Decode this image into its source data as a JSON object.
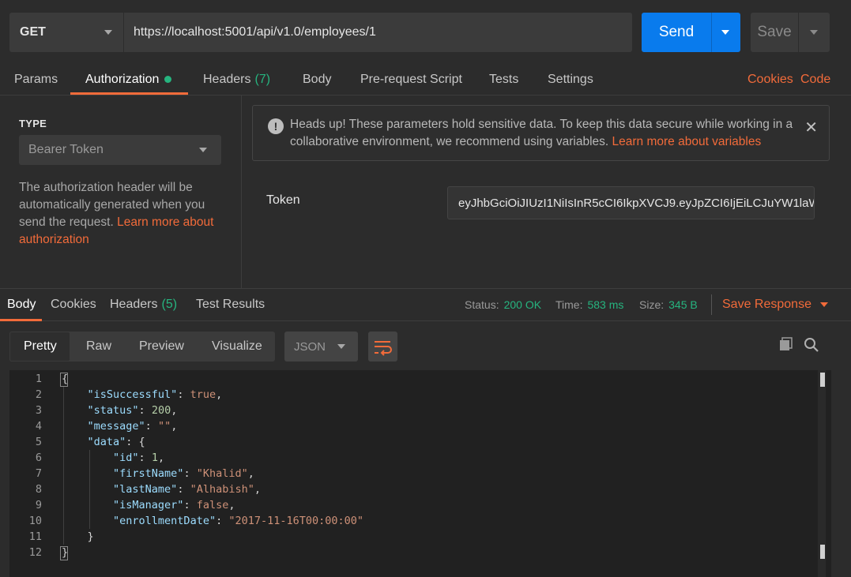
{
  "request": {
    "method": "GET",
    "url": "https://localhost:5001/api/v1.0/employees/1",
    "send_label": "Send",
    "save_label": "Save"
  },
  "request_tabs": {
    "params": "Params",
    "authorization": "Authorization",
    "headers": "Headers",
    "headers_count": "(7)",
    "body": "Body",
    "prerequest": "Pre-request Script",
    "tests": "Tests",
    "settings": "Settings",
    "cookies": "Cookies",
    "code": "Code"
  },
  "auth": {
    "type_label": "TYPE",
    "type_value": "Bearer Token",
    "desc_text": "The authorization header will be automatically generated when you send the request. ",
    "desc_link": "Learn more about authorization",
    "notice_text": "Heads up! These parameters hold sensitive data. To keep this data secure while working in a collaborative environment, we recommend using variables. ",
    "notice_link": "Learn more about variables",
    "token_label": "Token",
    "token_value": "eyJhbGciOiJIUzI1NiIsInR5cCI6IkpXVCJ9.eyJpZCI6IjEiLCJuYW1laW…"
  },
  "response_tabs": {
    "body": "Body",
    "cookies": "Cookies",
    "headers": "Headers",
    "headers_count": "(5)",
    "test_results": "Test Results"
  },
  "response_status": {
    "status_label": "Status:",
    "status_value": "200 OK",
    "time_label": "Time:",
    "time_value": "583 ms",
    "size_label": "Size:",
    "size_value": "345 B",
    "save_response": "Save Response"
  },
  "view": {
    "pretty": "Pretty",
    "raw": "Raw",
    "preview": "Preview",
    "visualize": "Visualize",
    "format": "JSON"
  },
  "code_lines": [
    "1",
    "2",
    "3",
    "4",
    "5",
    "6",
    "7",
    "8",
    "9",
    "10",
    "11",
    "12"
  ],
  "json_body": {
    "k_isSuccessful": "\"isSuccessful\"",
    "v_isSuccessful": "true",
    "k_status": "\"status\"",
    "v_status": "200",
    "k_message": "\"message\"",
    "v_message": "\"\"",
    "k_data": "\"data\"",
    "k_id": "\"id\"",
    "v_id": "1",
    "k_firstName": "\"firstName\"",
    "v_firstName": "\"Khalid\"",
    "k_lastName": "\"lastName\"",
    "v_lastName": "\"Alhabish\"",
    "k_isManager": "\"isManager\"",
    "v_isManager": "false",
    "k_enrollmentDate": "\"enrollmentDate\"",
    "v_enrollmentDate": "\"2017-11-16T00:00:00\""
  },
  "colors": {
    "accent_orange": "#f26b3a",
    "send_blue": "#097bed",
    "status_green": "#26b47f"
  },
  "icons": [
    "chevron-down-icon",
    "info-icon",
    "close-icon",
    "wrap-lines-icon",
    "copy-icon",
    "search-icon"
  ]
}
